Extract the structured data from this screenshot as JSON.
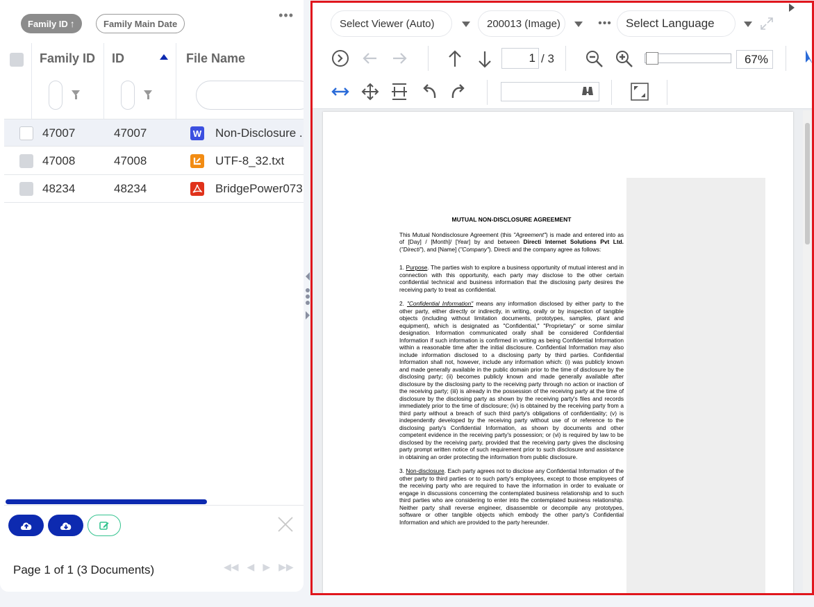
{
  "sort_chips": {
    "family_id": "Family ID",
    "family_main_date": "Family Main Date"
  },
  "grid": {
    "columns": {
      "family_id": "Family ID",
      "id": "ID",
      "file_name": "File Name"
    },
    "rows": [
      {
        "family_id": "47007",
        "id": "47007",
        "file_name": "Non-Disclosure ...",
        "type": "word",
        "icon_color": "#3b4fe0",
        "icon_glyph": "W",
        "selected": true
      },
      {
        "family_id": "47008",
        "id": "47008",
        "file_name": "UTF-8_32.txt",
        "type": "text",
        "icon_color": "#f28c13",
        "icon_glyph": "L",
        "selected": false
      },
      {
        "family_id": "48234",
        "id": "48234",
        "file_name": "BridgePower073",
        "type": "pdf",
        "icon_color": "#e0321b",
        "icon_glyph": "☠",
        "selected": false
      }
    ]
  },
  "footer": {
    "page_info": "Page 1 of 1 (3 Documents)"
  },
  "viewer": {
    "select_viewer": "Select Viewer (Auto)",
    "document_select": "200013 (Image)",
    "select_language": "Select Language",
    "current_page": "1",
    "total_pages": "/ 3",
    "zoom": "67%",
    "zoom_level": 0.05
  },
  "document": {
    "title": "MUTUAL NON-DISCLOSURE AGREEMENT",
    "intro_1": "This Mutual Nondisclosure Agreement (this ",
    "intro_agreement": "\"Agreement\"",
    "intro_2": ") is made and entered into as of [Day] / [Month]/ [Year] by and between ",
    "intro_company": "Directi Internet Solutions Pvt Ltd.",
    "intro_3": " (",
    "intro_directi": "\"Directi\"",
    "intro_4": "), and [Name] (",
    "intro_company2": "\"Company\"",
    "intro_5": "). Directi and the company agree as follows:",
    "s1_num": "1. ",
    "s1_head": "Purpose",
    "s1_body": ". The parties wish to explore a business opportunity of mutual interest and in connection with this opportunity, each party may disclose to the other certain confidential technical and business information that the disclosing party desires the receiving party to treat as confidential.",
    "s2_num": "2. ",
    "s2_head": "\"Confidential Information\"",
    "s2_body": " means any information disclosed by either party to the other party, either directly or indirectly, in writing, orally or by inspection of tangible objects (including without limitation documents, prototypes, samples, plant and equipment), which is designated as \"Confidential,\" \"Proprietary\" or some similar designation. Information communicated orally shall be considered Confidential Information if such information is confirmed in writing as being Confidential Information within a reasonable time after the initial disclosure. Confidential Information may also include information disclosed to a disclosing party by third parties. Confidential Information shall not, however, include any information which: (i) was publicly known and made generally available in the public domain prior to the time of disclosure by the disclosing party; (ii) becomes publicly known and made generally available after disclosure by the disclosing party to the receiving party through no action or inaction of the receiving party; (iii) is already in the possession of the receiving party at the time of disclosure by the disclosing party as shown by the receiving party's files and records immediately prior to the time of disclosure; (iv) is obtained by the receiving party from a third party without a breach of such third party's obligations of confidentiality; (v) is independently developed by the receiving party without use of or reference to the disclosing party's Confidential Information, as shown by documents and other competent evidence in the receiving party's possession; or (vi) is required by law to be disclosed by the receiving party, provided that the receiving party gives the disclosing party prompt written notice of such requirement prior to such disclosure and assistance in obtaining an order protecting the information from public disclosure.",
    "s3_num": "3. ",
    "s3_head": "Non-disclosure",
    "s3_body": ". Each party agrees not to disclose any Confidential Information of the other party to third parties or to such party's employees, except to those employees of the receiving party who are required to have the information in order to evaluate or engage in discussions concerning the contemplated business relationship and to such third parties who are considering to enter into the contemplated business relationship. Neither party shall reverse engineer, disassemble or decompile any prototypes, software or other tangible objects which embody the other party's Confidential Information and which are provided to the party hereunder."
  }
}
